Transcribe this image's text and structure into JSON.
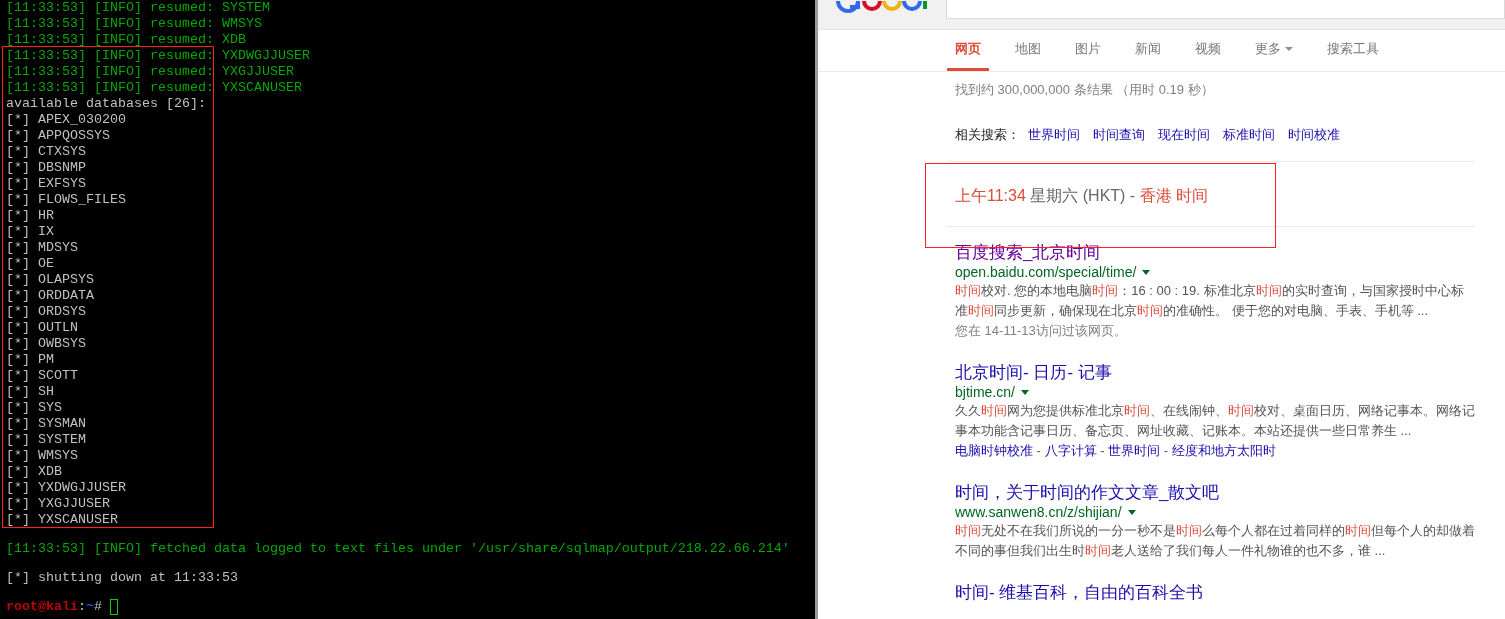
{
  "terminal": {
    "lines": [
      {
        "kind": "info",
        "text": "[11:33:53] [INFO] resumed: SYSTEM"
      },
      {
        "kind": "info",
        "text": "[11:33:53] [INFO] resumed: WMSYS"
      },
      {
        "kind": "info",
        "text": "[11:33:53] [INFO] resumed: XDB"
      },
      {
        "kind": "info",
        "text": "[11:33:53] [INFO] resumed: YXDWGJJUSER"
      },
      {
        "kind": "info",
        "text": "[11:33:53] [INFO] resumed: YXGJJUSER"
      },
      {
        "kind": "info",
        "text": "[11:33:53] [INFO] resumed: YXSCANUSER"
      },
      {
        "kind": "plain",
        "text": "available databases [26]:"
      },
      {
        "kind": "plain",
        "text": "[*] APEX_030200"
      },
      {
        "kind": "plain",
        "text": "[*] APPQOSSYS"
      },
      {
        "kind": "plain",
        "text": "[*] CTXSYS"
      },
      {
        "kind": "plain",
        "text": "[*] DBSNMP"
      },
      {
        "kind": "plain",
        "text": "[*] EXFSYS"
      },
      {
        "kind": "plain",
        "text": "[*] FLOWS_FILES"
      },
      {
        "kind": "plain",
        "text": "[*] HR"
      },
      {
        "kind": "plain",
        "text": "[*] IX"
      },
      {
        "kind": "plain",
        "text": "[*] MDSYS"
      },
      {
        "kind": "plain",
        "text": "[*] OE"
      },
      {
        "kind": "plain",
        "text": "[*] OLAPSYS"
      },
      {
        "kind": "plain",
        "text": "[*] ORDDATA"
      },
      {
        "kind": "plain",
        "text": "[*] ORDSYS"
      },
      {
        "kind": "plain",
        "text": "[*] OUTLN"
      },
      {
        "kind": "plain",
        "text": "[*] OWBSYS"
      },
      {
        "kind": "plain",
        "text": "[*] PM"
      },
      {
        "kind": "plain",
        "text": "[*] SCOTT"
      },
      {
        "kind": "plain",
        "text": "[*] SH"
      },
      {
        "kind": "plain",
        "text": "[*] SYS"
      },
      {
        "kind": "plain",
        "text": "[*] SYSMAN"
      },
      {
        "kind": "plain",
        "text": "[*] SYSTEM"
      },
      {
        "kind": "plain",
        "text": "[*] WMSYS"
      },
      {
        "kind": "plain",
        "text": "[*] XDB"
      },
      {
        "kind": "plain",
        "text": "[*] YXDWGJJUSER"
      },
      {
        "kind": "plain",
        "text": "[*] YXGJJUSER"
      },
      {
        "kind": "plain",
        "text": "[*] YXSCANUSER"
      },
      {
        "kind": "blank"
      },
      {
        "kind": "info",
        "text": "[11:33:53] [INFO] fetched data logged to text files under '/usr/share/sqlmap/output/218.22.66.214'"
      },
      {
        "kind": "blank"
      },
      {
        "kind": "plain",
        "text": "[*] shutting down at 11:33:53"
      },
      {
        "kind": "blank"
      },
      {
        "kind": "prompt",
        "user": "root@kali",
        "sep": ":",
        "path": "~",
        "symbol": "#"
      }
    ]
  },
  "browser": {
    "tabs": [
      {
        "label": "网页",
        "selected": true
      },
      {
        "label": "地图",
        "selected": false
      },
      {
        "label": "图片",
        "selected": false
      },
      {
        "label": "新闻",
        "selected": false
      },
      {
        "label": "视频",
        "selected": false
      },
      {
        "label": "更多",
        "selected": false,
        "dropdown": true
      },
      {
        "label": "搜索工具",
        "selected": false
      }
    ],
    "result_stats": "找到约 300,000,000 条结果 （用时 0.19 秒）",
    "related": {
      "label": "相关搜索：",
      "links": [
        "世界时间",
        "时间查询",
        "现在时间",
        "标准时间",
        "时间校准"
      ]
    },
    "time_answer": [
      {
        "text": "上午11:34",
        "hl": true
      },
      {
        "text": " 星期六 (HKT) - ",
        "hl": false
      },
      {
        "text": "香港 时间",
        "hl": true
      }
    ],
    "results": [
      {
        "title": "百度搜索_北京时间",
        "visited": true,
        "url": "open.baidu.com/special/time/",
        "snippet": [
          {
            "text": "时间",
            "hl": true
          },
          {
            "text": "校对. 您的本地电脑",
            "hl": false
          },
          {
            "text": "时间",
            "hl": true
          },
          {
            "text": "：16 : 00 : 19. 标准北京",
            "hl": false
          },
          {
            "text": "时间",
            "hl": true
          },
          {
            "text": "的实时查询，与国家授时中心标准",
            "hl": false
          },
          {
            "text": "时间",
            "hl": true
          },
          {
            "text": "同步更新，确保现在北京",
            "hl": false
          },
          {
            "text": "时间",
            "hl": true
          },
          {
            "text": "的准确性。 便于您的对电脑、手表、手机等 ...",
            "hl": false
          }
        ],
        "visited_note": "您在 14-11-13访问过该网页。"
      },
      {
        "title": "北京时间- 日历- 记事",
        "visited": false,
        "url": "bjtime.cn/",
        "snippet": [
          {
            "text": "久久",
            "hl": false
          },
          {
            "text": "时间",
            "hl": true
          },
          {
            "text": "网为您提供标准北京",
            "hl": false
          },
          {
            "text": "时间",
            "hl": true
          },
          {
            "text": "、在线闹钟、",
            "hl": false
          },
          {
            "text": "时间",
            "hl": true
          },
          {
            "text": "校对、桌面日历、网络记事本。网络记事本功能含记事日历、备忘页、网址收藏、记账本。本站还提供一些日常养生 ...",
            "hl": false
          }
        ],
        "sitelinks": [
          "电脑时钟校准",
          "八字计算",
          "世界时间",
          "经度和地方太阳时"
        ],
        "sitelink_sep": " - "
      },
      {
        "title": "时间，关于时间的作文文章_散文吧",
        "visited": false,
        "url": "www.sanwen8.cn/z/shijian/",
        "snippet": [
          {
            "text": "时间",
            "hl": true
          },
          {
            "text": "无处不在我们所说的一分一秒不是",
            "hl": false
          },
          {
            "text": "时间",
            "hl": true
          },
          {
            "text": "么每个人都在过着同样的",
            "hl": false
          },
          {
            "text": "时间",
            "hl": true
          },
          {
            "text": "但每个人的却做着不同的事但我们出生时",
            "hl": false
          },
          {
            "text": "时间",
            "hl": true
          },
          {
            "text": "老人送给了我们每人一件礼物谁的也不多，谁 ...",
            "hl": false
          }
        ]
      },
      {
        "title": "时间- 维基百科，自由的百科全书",
        "visited": false
      }
    ]
  }
}
